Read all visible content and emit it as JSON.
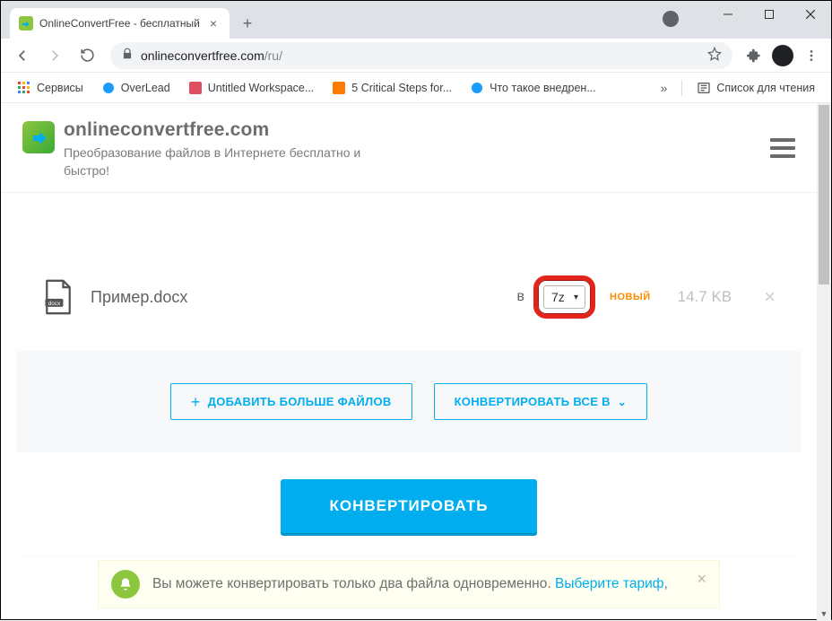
{
  "window": {
    "tab_title": "OnlineConvertFree - бесплатный",
    "new_tab": "+"
  },
  "address": {
    "host": "onlineconvertfree.com",
    "path": "/ru/"
  },
  "bookmarks": {
    "apps": "Сервисы",
    "items": [
      {
        "label": "OverLead"
      },
      {
        "label": "Untitled Workspace..."
      },
      {
        "label": "5 Critical Steps for..."
      },
      {
        "label": "Что такое внедрен..."
      }
    ],
    "more": "»",
    "reading_list": "Список для чтения"
  },
  "site": {
    "brand": "onlineconvertfree.com",
    "tagline": "Преобразование файлов в Интернете бесплатно и быстро!"
  },
  "file_row": {
    "ext_badge": "docx",
    "filename": "Пример.docx",
    "to_label": "в",
    "format_value": "7z",
    "new_badge": "НОВЫЙ",
    "size": "14.7 KB"
  },
  "actions": {
    "add_more": "ДОБАВИТЬ БОЛЬШЕ ФАЙЛОВ",
    "convert_all_to": "КОНВЕРТИРОВАТЬ ВСЕ В"
  },
  "convert": {
    "label": "КОНВЕРТИРОВАТЬ"
  },
  "notice": {
    "text": "Вы можете конвертировать только два файла одновременно. ",
    "link": "Выберите тариф"
  }
}
